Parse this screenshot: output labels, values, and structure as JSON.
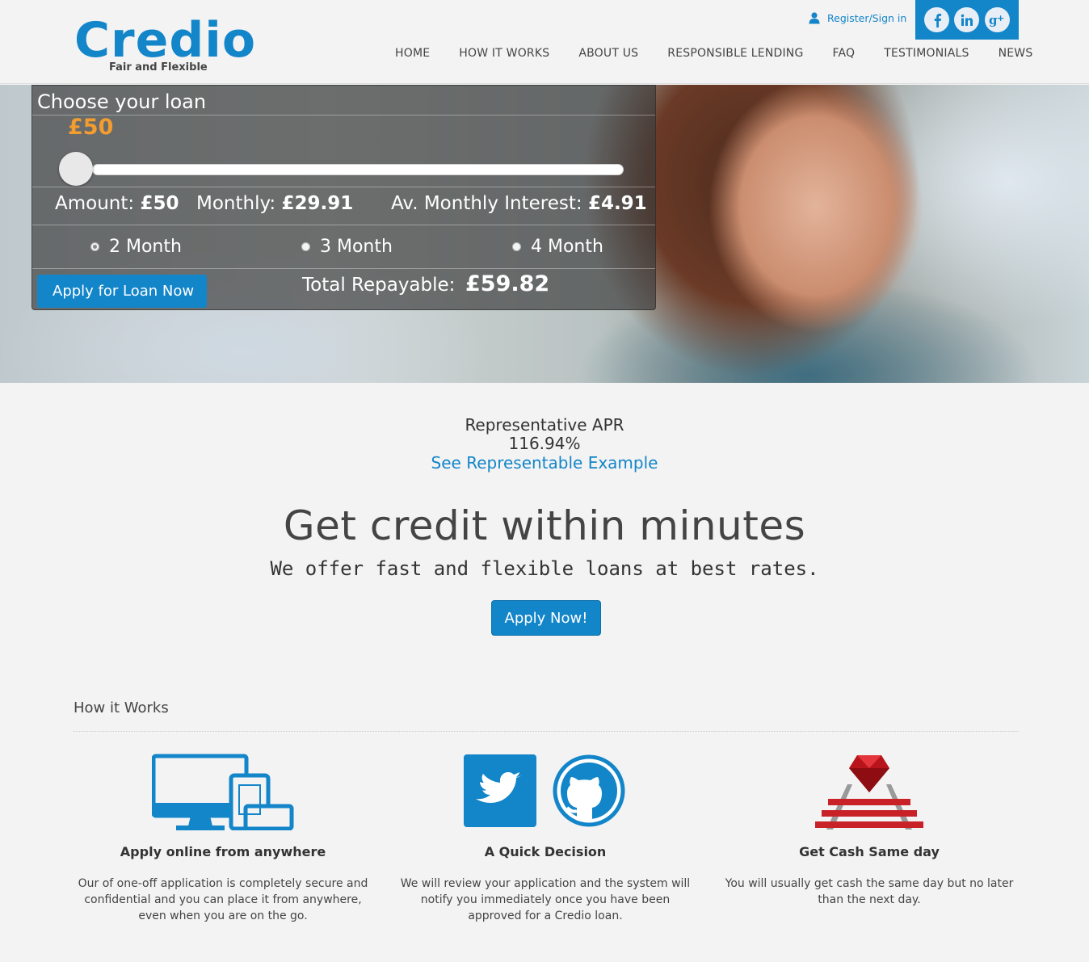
{
  "brand": {
    "name": "Credio",
    "tagline": "Fair and Flexible",
    "accent": "#1385c9",
    "amount_color": "#f39c2f"
  },
  "header": {
    "register_label": "Register/Sign in",
    "social": [
      "facebook-icon",
      "linkedin-icon",
      "google-plus-icon"
    ],
    "nav": [
      "HOME",
      "HOW IT WORKS",
      "ABOUT US",
      "RESPONSIBLE LENDING",
      "FAQ",
      "TESTIMONIALS",
      "NEWS"
    ]
  },
  "calculator": {
    "title": "Choose your loan",
    "amount_display": "£50",
    "slider_fraction": 0.0,
    "amount_label": "Amount:",
    "amount_value": "£50",
    "monthly_label": "Monthly:",
    "monthly_value": "£29.91",
    "interest_label": "Av. Monthly Interest:",
    "interest_value": "£4.91",
    "terms": [
      {
        "label": "2 Month",
        "selected": true
      },
      {
        "label": "3 Month",
        "selected": false
      },
      {
        "label": "4 Month",
        "selected": false
      }
    ],
    "apply_label": "Apply for Loan Now",
    "total_label": "Total Repayable:",
    "total_value": "£59.82"
  },
  "apr": {
    "title": "Representative APR",
    "value": "116.94%",
    "link": "See Representable Example"
  },
  "hero": {
    "headline": "Get credit within minutes",
    "subheadline": "We offer fast and flexible loans at best rates.",
    "cta": "Apply Now!"
  },
  "how_it_works": {
    "title": "How it Works",
    "features": [
      {
        "icon": "devices-icon",
        "title": "Apply online from anywhere",
        "text": "Our of one-off application is completely secure and confidential and you can place it from anywhere, even when you are on the go."
      },
      {
        "icon": "twitter-github-icon",
        "title": "A Quick Decision",
        "text": "We will review your application and the system will notify you immediately once you have been approved for a Credio loan."
      },
      {
        "icon": "ruby-rails-icon",
        "title": "Get Cash Same day",
        "text": "You will usually get cash the same day but no later than the next day."
      }
    ]
  }
}
